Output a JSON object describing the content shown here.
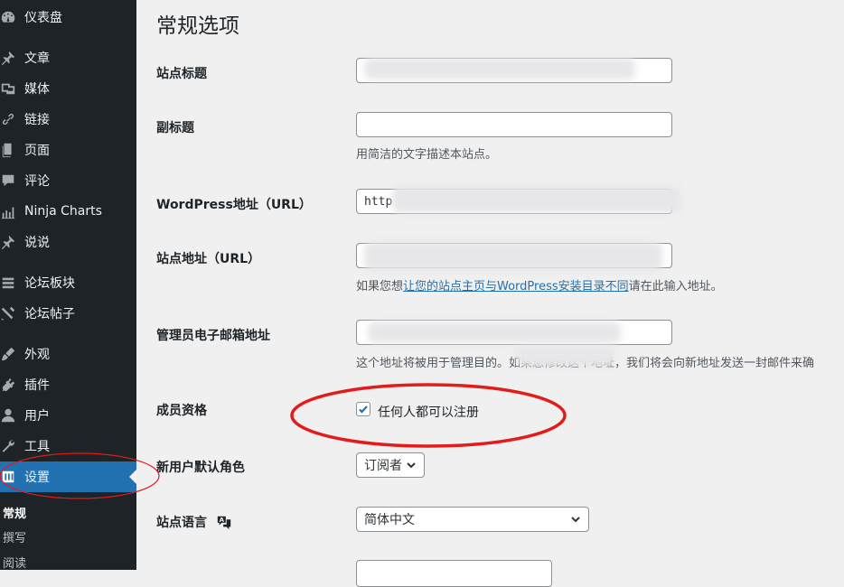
{
  "sidebar": {
    "items": [
      {
        "label": "仪表盘",
        "icon": "dashboard-icon"
      },
      {
        "label": "文章",
        "icon": "pin-icon"
      },
      {
        "label": "媒体",
        "icon": "media-icon"
      },
      {
        "label": "链接",
        "icon": "link-icon"
      },
      {
        "label": "页面",
        "icon": "page-icon"
      },
      {
        "label": "评论",
        "icon": "comment-icon"
      },
      {
        "label": "Ninja Charts",
        "icon": "chart-icon"
      },
      {
        "label": "说说",
        "icon": "pin-icon"
      },
      {
        "label": "论坛板块",
        "icon": "forum-icon"
      },
      {
        "label": "论坛帖子",
        "icon": "topic-icon"
      },
      {
        "label": "外观",
        "icon": "brush-icon"
      },
      {
        "label": "插件",
        "icon": "plugin-icon"
      },
      {
        "label": "用户",
        "icon": "user-icon"
      },
      {
        "label": "工具",
        "icon": "wrench-icon"
      },
      {
        "label": "设置",
        "icon": "settings-icon"
      }
    ],
    "submenu": [
      "常规",
      "撰写",
      "阅读"
    ]
  },
  "main": {
    "title": "常规选项",
    "site_title": {
      "label": "站点标题",
      "value": ""
    },
    "tagline": {
      "label": "副标题",
      "value": "",
      "desc": "用简洁的文字描述本站点。"
    },
    "wp_url": {
      "label": "WordPress地址（URL）",
      "value": "http"
    },
    "site_url": {
      "label": "站点地址（URL）",
      "value": "",
      "desc_pre": "如果您想",
      "desc_link": "让您的站点主页与WordPress安装目录不同",
      "desc_post": "请在此输入地址。"
    },
    "admin_email": {
      "label": "管理员电子邮箱地址",
      "value": "",
      "desc": "这个地址将被用于管理目的。如果您修改这个地址，我们将会向新地址发送一封邮件来确"
    },
    "membership": {
      "label": "成员资格",
      "checkbox_label": "任何人都可以注册",
      "checked": true
    },
    "default_role": {
      "label": "新用户默认角色",
      "value": "订阅者"
    },
    "site_language": {
      "label": "站点语言",
      "value": "简体中文"
    }
  },
  "colors": {
    "sidebar": "#1d2327",
    "active": "#2271b1",
    "annotation": "#e21b1b"
  }
}
